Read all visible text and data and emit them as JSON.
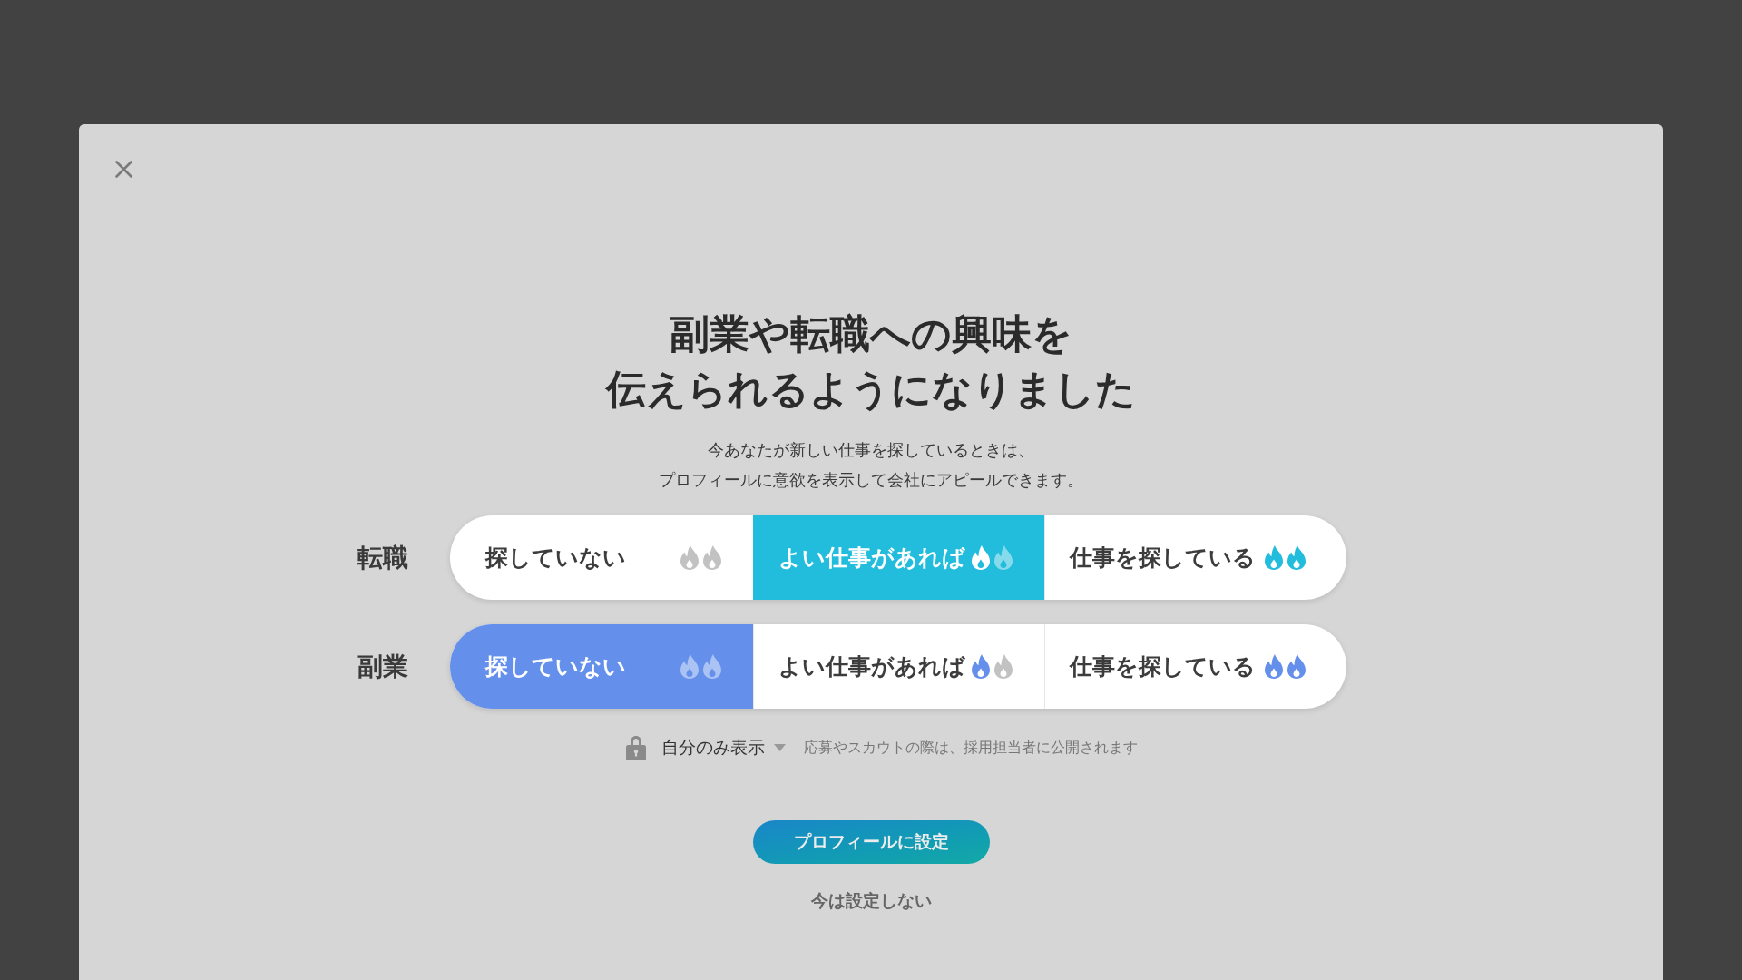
{
  "dialog": {
    "title_lines": [
      "副業や転職への興味を",
      "伝えられるようになりました"
    ],
    "description_lines": [
      "今あなたが新しい仕事を探しているときは、",
      "プロフィールに意欲を表示して会社にアピールできます。"
    ],
    "rows": [
      {
        "label": "転職",
        "color": "#22bcdc",
        "options": [
          {
            "label": "探していない",
            "selected": false,
            "flames": [
              {
                "on": false
              },
              {
                "on": false
              }
            ]
          },
          {
            "label": "よい仕事があれば",
            "selected": true,
            "flames": [
              {
                "on": true
              },
              {
                "on": false
              }
            ]
          },
          {
            "label": "仕事を探している",
            "selected": false,
            "flames": [
              {
                "on": true
              },
              {
                "on": true
              }
            ]
          }
        ]
      },
      {
        "label": "副業",
        "color": "#6490ec",
        "options": [
          {
            "label": "探していない",
            "selected": true,
            "flames": [
              {
                "on": false
              },
              {
                "on": false
              }
            ]
          },
          {
            "label": "よい仕事があれば",
            "selected": false,
            "flames": [
              {
                "on": true
              },
              {
                "on": false
              }
            ]
          },
          {
            "label": "仕事を探している",
            "selected": false,
            "flames": [
              {
                "on": true
              },
              {
                "on": true
              }
            ]
          }
        ]
      }
    ],
    "visibility": {
      "value": "自分のみ表示",
      "note": "応募やスカウトの際は、採用担当者に公開されます"
    },
    "primary_button": "プロフィールに設定",
    "secondary_link": "今は設定しない"
  }
}
